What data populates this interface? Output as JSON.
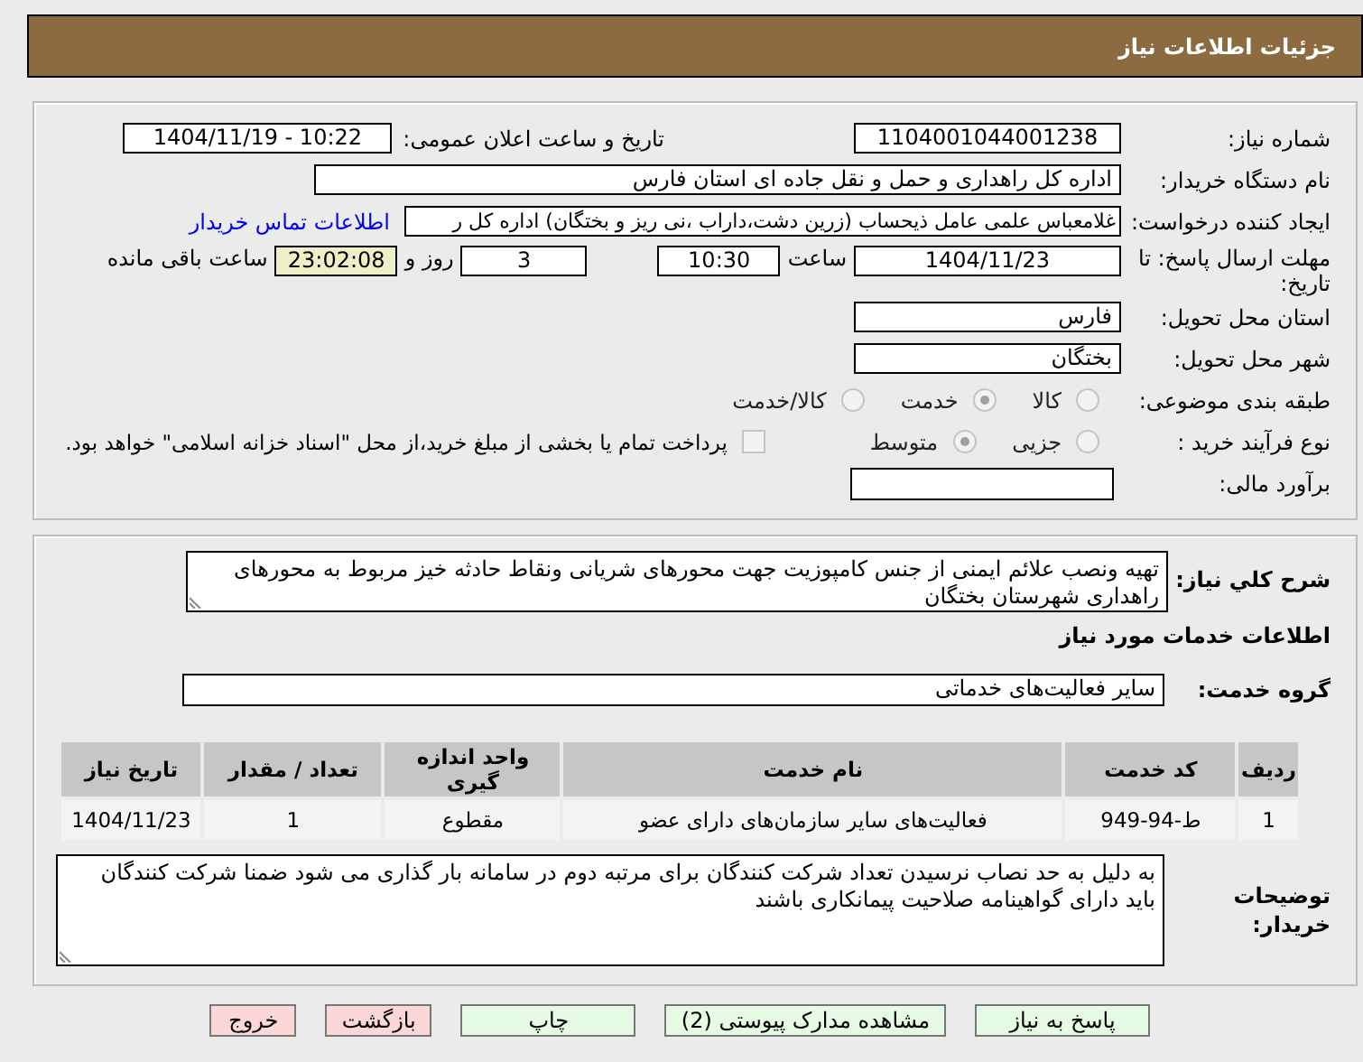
{
  "header": {
    "title": "جزئیات اطلاعات نیاز"
  },
  "details": {
    "need_number": {
      "label": "شماره نیاز:",
      "value": "1104001044001238"
    },
    "announce": {
      "label": "تاریخ و ساعت اعلان عمومی:",
      "value": "1404/11/19 - 10:22"
    },
    "buyer": {
      "label": "نام دستگاه خریدار:",
      "value": "اداره کل راهداری و حمل و نقل جاده ای استان فارس"
    },
    "creator": {
      "label": "ایجاد کننده درخواست:",
      "value": "غلامعباس علمی عامل ذیحساب (زرین دشت،داراب ،نی ریز و بختگان) اداره کل ر",
      "link": "اطلاعات تماس خریدار"
    },
    "deadline": {
      "label": "مهلت ارسال پاسخ: تا تاریخ:",
      "date": "1404/11/23",
      "time_label": "ساعت",
      "time": "10:30",
      "days": "3",
      "days_label": "روز و",
      "remaining": "23:02:08",
      "remaining_label": "ساعت باقی مانده"
    },
    "province": {
      "label": "استان محل تحویل:",
      "value": "فارس"
    },
    "city": {
      "label": "شهر محل تحویل:",
      "value": "بختگان"
    },
    "category": {
      "label": "طبقه بندی موضوعی:",
      "options": [
        {
          "label": "کالا",
          "selected": false
        },
        {
          "label": "خدمت",
          "selected": true
        },
        {
          "label": "کالا/خدمت",
          "selected": false
        }
      ]
    },
    "process": {
      "label": "نوع فرآیند خرید :",
      "options": [
        {
          "label": "جزیی",
          "selected": false
        },
        {
          "label": "متوسط",
          "selected": true
        }
      ],
      "treasury": {
        "checked": false,
        "text": "پرداخت تمام یا بخشی از مبلغ خرید،از محل \"اسناد خزانه اسلامی\" خواهد بود."
      }
    },
    "estimate": {
      "label": "برآورد مالی:"
    }
  },
  "description": {
    "label": "شرح کلي نیاز:",
    "value": "تهیه ونصب علائم ایمنی از جنس کامپوزیت جهت محورهای شریانی ونقاط حادثه خیز مربوط به محورهای راهداری شهرستان  بختگان"
  },
  "services": {
    "heading": "اطلاعات خدمات مورد نیاز",
    "group": {
      "label": "گروه خدمت:",
      "value": "سایر فعالیت‌های خدماتی"
    },
    "table": {
      "columns": [
        "ردیف",
        "کد خدمت",
        "نام خدمت",
        "واحد اندازه گیری",
        "تعداد / مقدار",
        "تاریخ نیاز"
      ],
      "rows": [
        [
          "1",
          "ط-94-949",
          "فعالیت‌های سایر سازمان‌های دارای عضو",
          "مقطوع",
          "1",
          "1404/11/23"
        ]
      ]
    }
  },
  "buyer_notes": {
    "label": "توضیحات خریدار:",
    "value": "به دلیل به حد نصاب نرسیدن تعداد شرکت کنندگان برای مرتبه دوم در سامانه بار گذاری می شود ضمنا شرکت کنندگان باید دارای گواهینامه صلاحیت پیمانکاری باشند"
  },
  "buttons": [
    {
      "label": "پاسخ به نیاز",
      "kind": "action"
    },
    {
      "label": "مشاهده مدارک پیوستی (2)",
      "kind": "action"
    },
    {
      "label": "چاپ",
      "kind": "action"
    },
    {
      "label": "بازگشت",
      "kind": "exit"
    },
    {
      "label": "خروج",
      "kind": "exit"
    }
  ]
}
